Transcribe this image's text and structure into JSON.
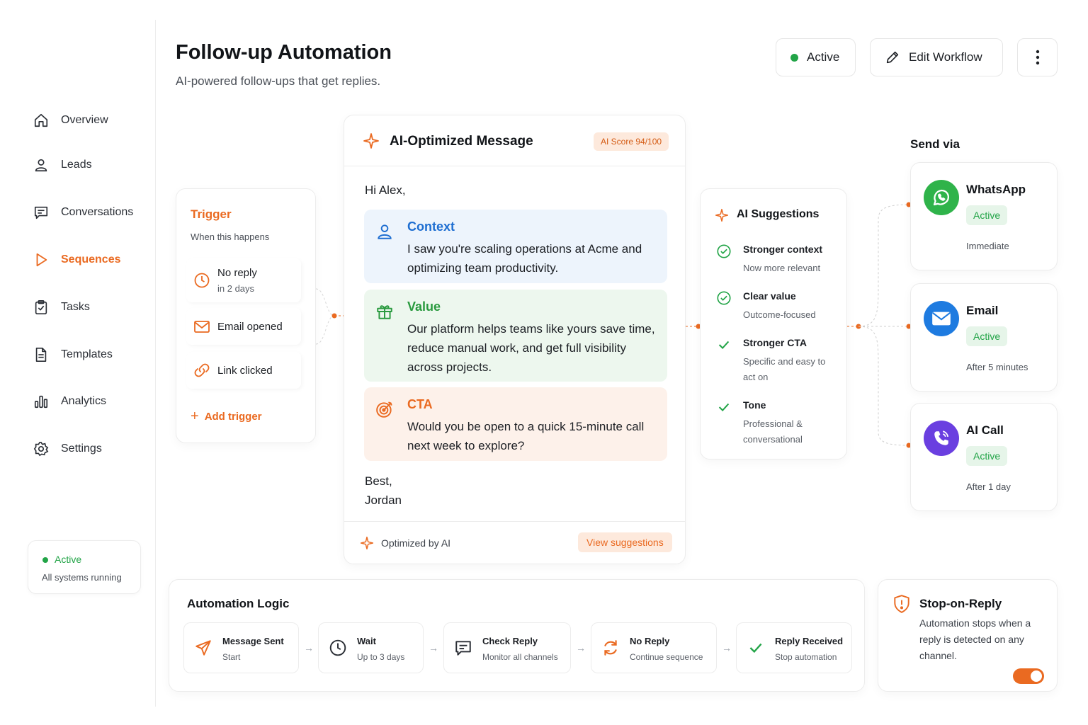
{
  "sidebar": {
    "items": [
      {
        "label": "Overview",
        "icon": "home-icon"
      },
      {
        "label": "Leads",
        "icon": "user-icon"
      },
      {
        "label": "Conversations",
        "icon": "chat-icon"
      },
      {
        "label": "Sequences",
        "icon": "play-icon",
        "active": true
      },
      {
        "label": "Tasks",
        "icon": "clipboard-check-icon"
      },
      {
        "label": "Templates",
        "icon": "document-icon"
      },
      {
        "label": "Analytics",
        "icon": "bar-chart-icon"
      },
      {
        "label": "Settings",
        "icon": "gear-icon"
      }
    ],
    "status": {
      "label": "Active",
      "detail": "All systems running"
    }
  },
  "header": {
    "title": "Follow-up Automation",
    "subtitle": "AI-powered follow-ups that get replies.",
    "status_label": "Active",
    "edit_label": "Edit Workflow"
  },
  "trigger": {
    "title": "Trigger",
    "subtitle": "When this happens",
    "items": [
      {
        "label": "No reply",
        "detail": "in 2 days",
        "icon": "clock-icon"
      },
      {
        "label": "Email opened",
        "icon": "mail-icon"
      },
      {
        "label": "Link clicked",
        "icon": "link-icon"
      }
    ],
    "add_label": "Add trigger"
  },
  "message": {
    "title": "AI-Optimized Message",
    "score": "AI Score 94/100",
    "greeting": "Hi Alex,",
    "blocks": {
      "context": {
        "heading": "Context",
        "body": "I saw you're scaling operations at Acme and optimizing team productivity."
      },
      "value": {
        "heading": "Value",
        "body": "Our platform helps teams like yours save time, reduce manual work, and get full visibility across projects."
      },
      "cta": {
        "heading": "CTA",
        "body": "Would you be open to a quick 15-minute call next week to explore?"
      }
    },
    "signoff_1": "Best,",
    "signoff_2": "Jordan",
    "footer_label": "Optimized by AI",
    "view_suggestions": "View suggestions"
  },
  "suggestions": {
    "title": "AI Suggestions",
    "items": [
      {
        "heading": "Stronger context",
        "detail": "Now more relevant"
      },
      {
        "heading": "Clear value",
        "detail": "Outcome-focused"
      },
      {
        "heading": "Stronger CTA",
        "detail": "Specific and easy to act on"
      },
      {
        "heading": "Tone",
        "detail": "Professional & conversational"
      }
    ]
  },
  "send_via": {
    "label": "Send via",
    "channels": [
      {
        "name": "WhatsApp",
        "status": "Active",
        "timing": "Immediate",
        "color": "#2fb34a",
        "icon": "whatsapp-icon"
      },
      {
        "name": "Email",
        "status": "Active",
        "timing": "After 5 minutes",
        "color": "#1e7be0",
        "icon": "mail-icon"
      },
      {
        "name": "AI Call",
        "status": "Active",
        "timing": "After 1 day",
        "color": "#6a3fe0",
        "icon": "phone-icon"
      }
    ]
  },
  "logic": {
    "title": "Automation Logic",
    "steps": [
      {
        "heading": "Message Sent",
        "detail": "Start",
        "icon": "send-icon"
      },
      {
        "heading": "Wait",
        "detail": "Up to 3 days",
        "icon": "clock-icon"
      },
      {
        "heading": "Check Reply",
        "detail": "Monitor all channels",
        "icon": "chat-icon"
      },
      {
        "heading": "No Reply",
        "detail": "Continue sequence",
        "icon": "refresh-icon"
      },
      {
        "heading": "Reply Received",
        "detail": "Stop automation",
        "icon": "check-icon"
      }
    ]
  },
  "stop_on_reply": {
    "title": "Stop-on-Reply",
    "description": "Automation stops when a reply is detected on any channel.",
    "enabled": true
  },
  "colors": {
    "accent": "#ea6a21",
    "success": "#22a447",
    "context": "#1e6ed1",
    "value": "#2a9a3f"
  }
}
